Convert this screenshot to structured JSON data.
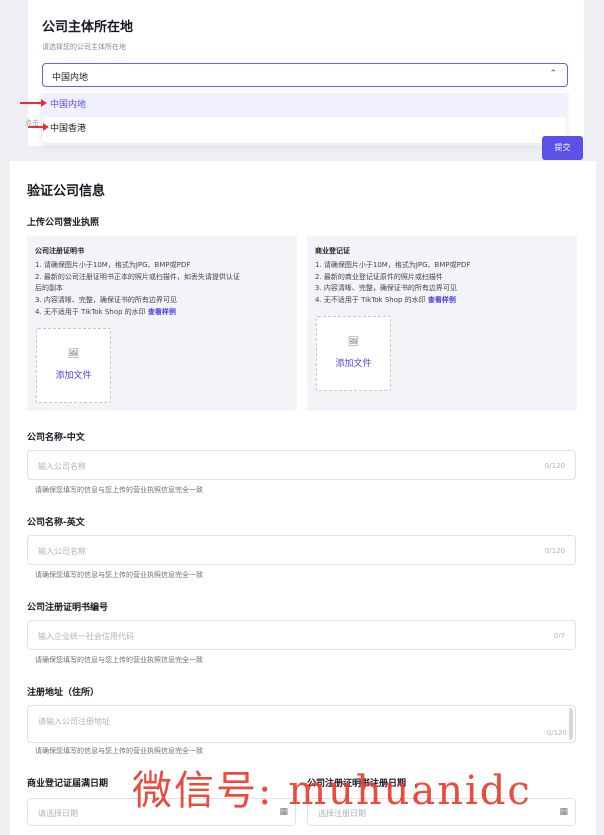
{
  "entity_location": {
    "title": "公司主体所在地",
    "subtitle": "请选择您的公司主体所在地",
    "selected": "中国内地",
    "chevron_icon": "chevron-up-icon",
    "options": [
      "中国内地",
      "中国香港"
    ]
  },
  "faint_text": "点击",
  "submit_label": "提交",
  "verify": {
    "title": "验证公司信息",
    "upload_section_title": "上传公司营业执照",
    "panels": [
      {
        "title": "公司注册证明书",
        "lines": [
          "1. 请确保图片小于10M，格式为JPG、BMP或PDF",
          "2. 最新的公司注册证明书正本的照片或扫描件，如丢失请提供认证",
          "后的副本",
          "3. 内容清晰、完整，确保证书的所有边界可见",
          "4. 无不适用于 TikTok Shop 的水印 "
        ],
        "link": "查看样例",
        "upload_label": "添加文件"
      },
      {
        "title": "商业登记证",
        "lines": [
          "1. 请确保图片小于10M，格式为JPG、BMP或PDF",
          "2. 最新的商业登记证原件的照片或扫描件",
          "3. 内容清晰、完整，确保证书的所有边界可见",
          "4. 无不适用于 TikTok Shop 的水印 "
        ],
        "link": "查看样例",
        "upload_label": "添加文件"
      }
    ]
  },
  "fields": {
    "name_cn": {
      "label": "公司名称-中文",
      "placeholder": "输入公司名称",
      "counter": "0/120",
      "hint": "请确保您填写的信息与您上传的营业执照信息完全一致"
    },
    "name_en": {
      "label": "公司名称-英文",
      "placeholder": "输入公司名称",
      "counter": "0/120",
      "hint": "请确保您填写的信息与您上传的营业执照信息完全一致"
    },
    "reg_no": {
      "label": "公司注册证明书编号",
      "placeholder": "输入企业统一社会信用代码",
      "counter": "0/7",
      "hint": "请确保您填写的信息与您上传的营业执照信息完全一致"
    },
    "address": {
      "label": "注册地址（住所）",
      "placeholder": "请输入公司注册地址",
      "counter": "0/120",
      "hint": "请确保您填写的信息与您上传的营业执照信息完全一致"
    },
    "br_expiry": {
      "label": "商业登记证届满日期",
      "placeholder": "请选择日期"
    },
    "ci_date": {
      "label": "公司注册证明书注册日期",
      "placeholder": "选择注册日期"
    }
  },
  "watermark": "微信号: muhuanidc",
  "colors": {
    "accent": "#5b50e8",
    "arrow": "#e5322f",
    "watermark": "#ea3b2e"
  }
}
